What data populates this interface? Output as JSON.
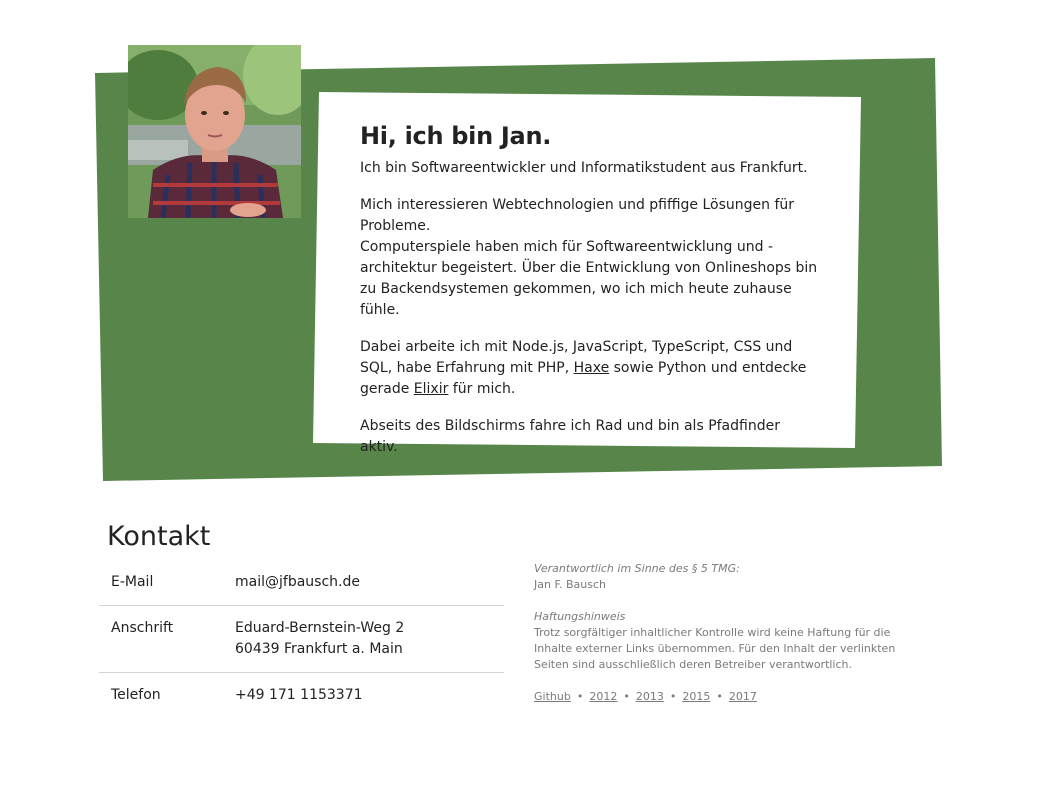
{
  "colors": {
    "accent_green": "#58864a",
    "card_white": "#ffffff",
    "text": "#222222",
    "muted": "#7a7a7a"
  },
  "profile": {
    "photo_icon": "portrait-photo"
  },
  "intro": {
    "heading": "Hi, ich bin Jan.",
    "p1": "Ich bin Softwareentwickler und Informatikstudent aus Frankfurt.",
    "p2_line1": "Mich interessieren Webtechnologien und pfiffige Lösungen für Probleme.",
    "p2_line2": "Computerspiele haben mich für Softwareentwicklung und -architektur begeistert. Über die Entwicklung von Onlineshops bin zu Backendsystemen gekommen, wo ich mich heute zuhause fühle.",
    "p3_before": "Dabei arbeite ich mit Node.js, JavaScript, TypeScript, CSS und SQL, habe Erfahrung mit PHP, ",
    "p3_link1": "Haxe",
    "p3_middle": " sowie Python und entdecke gerade ",
    "p3_link2": "Elixir",
    "p3_after": " für mich.",
    "p4": "Abseits des Bildschirms fahre ich Rad und bin als Pfadfinder aktiv."
  },
  "kontakt": {
    "title": "Kontakt",
    "email_label": "E-Mail",
    "email_value": "mail@jfbausch.de",
    "address_label": "Anschrift",
    "address_line1": "Eduard-Bernstein-Weg 2",
    "address_line2": "60439 Frankfurt a. Main",
    "phone_label": "Telefon",
    "phone_value": "+49 171 1153371"
  },
  "imprint": {
    "responsible_heading": "Verantwortlich im Sinne des § 5 TMG:",
    "responsible_name": "Jan F. Bausch",
    "liability_heading": "Haftungshinweis",
    "liability_text": "Trotz sorgfältiger inhaltlicher Kontrolle wird keine Haftung für die Inhalte externer Links übernommen. Für den Inhalt der verlinkten Seiten sind ausschließlich deren Betreiber verantwortlich.",
    "links": {
      "github": "Github",
      "y2012": "2012",
      "y2013": "2013",
      "y2015": "2015",
      "y2017": "2017",
      "separator": "•"
    }
  }
}
